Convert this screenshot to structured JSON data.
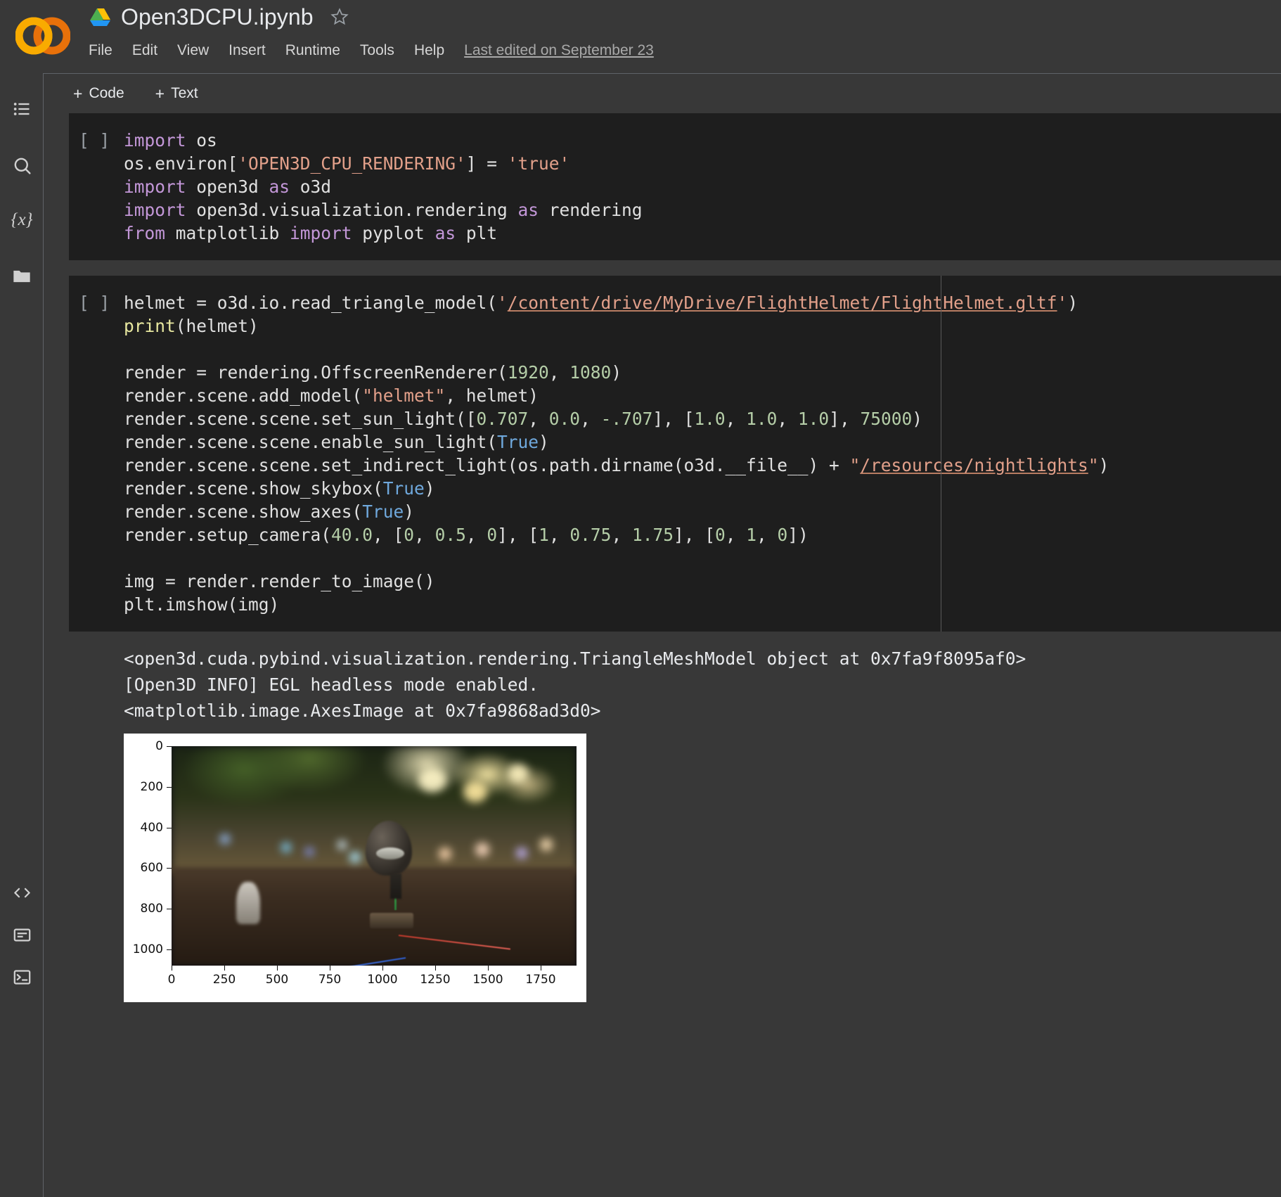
{
  "header": {
    "logo_name": "colab-logo",
    "drive_icon": "google-drive-icon",
    "doc_title": "Open3DCPU.ipynb",
    "star_icon": "star-outline-icon",
    "menu": [
      "File",
      "Edit",
      "View",
      "Insert",
      "Runtime",
      "Tools",
      "Help"
    ],
    "last_edited": "Last edited on September 23"
  },
  "rail": {
    "items": [
      {
        "name": "table-of-contents-icon",
        "glyph": "toc"
      },
      {
        "name": "search-icon",
        "glyph": "search"
      },
      {
        "name": "variables-icon",
        "glyph": "{x}"
      },
      {
        "name": "files-icon",
        "glyph": "folder"
      },
      {
        "name": "code-snippets-icon",
        "glyph": "<>"
      },
      {
        "name": "command-palette-icon",
        "glyph": "palette"
      },
      {
        "name": "terminal-icon",
        "glyph": ">_"
      }
    ]
  },
  "toolbar": {
    "add_code_label": "Code",
    "add_text_label": "Text",
    "plus": "+"
  },
  "cells": [
    {
      "execution_label": "[ ]",
      "lines": [
        [
          {
            "t": "import",
            "c": "kw"
          },
          {
            "t": " os",
            "c": "plain"
          }
        ],
        [
          {
            "t": "os.environ[",
            "c": "plain"
          },
          {
            "t": "'OPEN3D_CPU_RENDERING'",
            "c": "str"
          },
          {
            "t": "] = ",
            "c": "plain"
          },
          {
            "t": "'true'",
            "c": "str"
          }
        ],
        [
          {
            "t": "import",
            "c": "kw"
          },
          {
            "t": " open3d ",
            "c": "plain"
          },
          {
            "t": "as",
            "c": "kw"
          },
          {
            "t": " o3d",
            "c": "plain"
          }
        ],
        [
          {
            "t": "import",
            "c": "kw"
          },
          {
            "t": " open3d.visualization.rendering ",
            "c": "plain"
          },
          {
            "t": "as",
            "c": "kw"
          },
          {
            "t": " rendering",
            "c": "plain"
          }
        ],
        [
          {
            "t": "from",
            "c": "kw"
          },
          {
            "t": " matplotlib ",
            "c": "plain"
          },
          {
            "t": "import",
            "c": "kw"
          },
          {
            "t": " pyplot ",
            "c": "plain"
          },
          {
            "t": "as",
            "c": "kw"
          },
          {
            "t": " plt",
            "c": "plain"
          }
        ]
      ]
    },
    {
      "execution_label": "[ ]",
      "lines": [
        [
          {
            "t": "helmet = o3d.io.read_triangle_model(",
            "c": "plain"
          },
          {
            "t": "'",
            "c": "str"
          },
          {
            "t": "/content/drive/MyDrive/FlightHelmet/FlightHelmet.gltf",
            "c": "link"
          },
          {
            "t": "'",
            "c": "str"
          },
          {
            "t": ")",
            "c": "plain"
          }
        ],
        [
          {
            "t": "print",
            "c": "fn"
          },
          {
            "t": "(helmet)",
            "c": "plain"
          }
        ],
        [],
        [
          {
            "t": "render = rendering.OffscreenRenderer(",
            "c": "plain"
          },
          {
            "t": "1920",
            "c": "num"
          },
          {
            "t": ", ",
            "c": "plain"
          },
          {
            "t": "1080",
            "c": "num"
          },
          {
            "t": ")",
            "c": "plain"
          }
        ],
        [
          {
            "t": "render.scene.add_model(",
            "c": "plain"
          },
          {
            "t": "\"helmet\"",
            "c": "str"
          },
          {
            "t": ", helmet)",
            "c": "plain"
          }
        ],
        [
          {
            "t": "render.scene.scene.set_sun_light([",
            "c": "plain"
          },
          {
            "t": "0.707",
            "c": "num"
          },
          {
            "t": ", ",
            "c": "plain"
          },
          {
            "t": "0.0",
            "c": "num"
          },
          {
            "t": ", ",
            "c": "plain"
          },
          {
            "t": "-.707",
            "c": "num"
          },
          {
            "t": "], [",
            "c": "plain"
          },
          {
            "t": "1.0",
            "c": "num"
          },
          {
            "t": ", ",
            "c": "plain"
          },
          {
            "t": "1.0",
            "c": "num"
          },
          {
            "t": ", ",
            "c": "plain"
          },
          {
            "t": "1.0",
            "c": "num"
          },
          {
            "t": "], ",
            "c": "plain"
          },
          {
            "t": "75000",
            "c": "num"
          },
          {
            "t": ")",
            "c": "plain"
          }
        ],
        [
          {
            "t": "render.scene.scene.enable_sun_light(",
            "c": "plain"
          },
          {
            "t": "True",
            "c": "bool"
          },
          {
            "t": ")",
            "c": "plain"
          }
        ],
        [
          {
            "t": "render.scene.scene.set_indirect_light(os.path.dirname(o3d.__file__) + ",
            "c": "plain"
          },
          {
            "t": "\"",
            "c": "str"
          },
          {
            "t": "/resources/nightlights",
            "c": "link"
          },
          {
            "t": "\"",
            "c": "str"
          },
          {
            "t": ")",
            "c": "plain"
          }
        ],
        [
          {
            "t": "render.scene.show_skybox(",
            "c": "plain"
          },
          {
            "t": "True",
            "c": "bool"
          },
          {
            "t": ")",
            "c": "plain"
          }
        ],
        [
          {
            "t": "render.scene.show_axes(",
            "c": "plain"
          },
          {
            "t": "True",
            "c": "bool"
          },
          {
            "t": ")",
            "c": "plain"
          }
        ],
        [
          {
            "t": "render.setup_camera(",
            "c": "plain"
          },
          {
            "t": "40.0",
            "c": "num"
          },
          {
            "t": ", [",
            "c": "plain"
          },
          {
            "t": "0",
            "c": "num"
          },
          {
            "t": ", ",
            "c": "plain"
          },
          {
            "t": "0.5",
            "c": "num"
          },
          {
            "t": ", ",
            "c": "plain"
          },
          {
            "t": "0",
            "c": "num"
          },
          {
            "t": "], [",
            "c": "plain"
          },
          {
            "t": "1",
            "c": "num"
          },
          {
            "t": ", ",
            "c": "plain"
          },
          {
            "t": "0.75",
            "c": "num"
          },
          {
            "t": ", ",
            "c": "plain"
          },
          {
            "t": "1.75",
            "c": "num"
          },
          {
            "t": "], [",
            "c": "plain"
          },
          {
            "t": "0",
            "c": "num"
          },
          {
            "t": ", ",
            "c": "plain"
          },
          {
            "t": "1",
            "c": "num"
          },
          {
            "t": ", ",
            "c": "plain"
          },
          {
            "t": "0",
            "c": "num"
          },
          {
            "t": "])",
            "c": "plain"
          }
        ],
        [],
        [
          {
            "t": "img = render.render_to_image()",
            "c": "plain"
          }
        ],
        [
          {
            "t": "plt.imshow(img)",
            "c": "plain"
          }
        ]
      ]
    }
  ],
  "output": {
    "lines": [
      "<open3d.cuda.pybind.visualization.rendering.TriangleMeshModel object at 0x7fa9f8095af0>",
      "[Open3D INFO] EGL headless mode enabled.",
      "<matplotlib.image.AxesImage at 0x7fa9868ad3d0>"
    ]
  },
  "chart_data": {
    "type": "heatmap",
    "title": "",
    "xlabel": "",
    "ylabel": "",
    "xlim": [
      0,
      1920
    ],
    "ylim": [
      1080,
      0
    ],
    "grid": false,
    "legend_position": "none",
    "xticks": [
      0,
      250,
      500,
      750,
      1000,
      1250,
      1500,
      1750
    ],
    "yticks": [
      0,
      200,
      400,
      600,
      800,
      1000
    ],
    "description": "Rendered Open3D image of a FlightHelmet model on a pedestal over a blurred night-lights skybox"
  },
  "colors": {
    "page_bg": "#383838",
    "code_bg": "#1e1e1e",
    "text": "#e8eaed",
    "muted": "#a9a9a9",
    "keyword": "#c397d8",
    "string": "#e2a08a",
    "number": "#b5cea8",
    "function": "#e8e8a0",
    "boolean": "#6fa8dc",
    "accent_orange": "#f9ab00"
  }
}
